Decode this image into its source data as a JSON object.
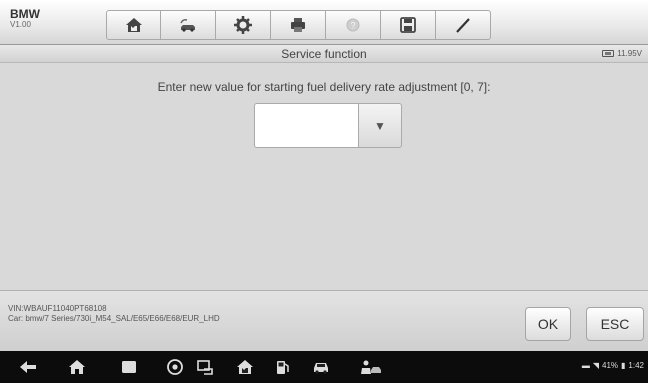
{
  "app": {
    "make": "BMW",
    "version": "V1.00"
  },
  "toolbar": {
    "items": [
      "home-icon",
      "vehicle-swap-icon",
      "settings-gear-icon",
      "print-icon",
      "help-icon",
      "save-icon",
      "pen-icon"
    ]
  },
  "header": {
    "title": "Service function",
    "voltage": "11.95V"
  },
  "main": {
    "prompt": "Enter new value for starting fuel delivery rate adjustment [0, 7]:",
    "value": "",
    "dropdown_icon": "triangle-down-icon"
  },
  "footer": {
    "vin": "VIN:WBAUF11040PT68108",
    "car": "Car: bmw/7 Series/730i_M54_SAL/E65/E66/E68/EUR_LHD",
    "ok_label": "OK",
    "esc_label": "ESC"
  },
  "status_bar": {
    "battery": "41%",
    "time": "1:42"
  },
  "colors": {
    "content_bg": "#d9d9d9",
    "navbar_bg": "#0c0c0c"
  }
}
